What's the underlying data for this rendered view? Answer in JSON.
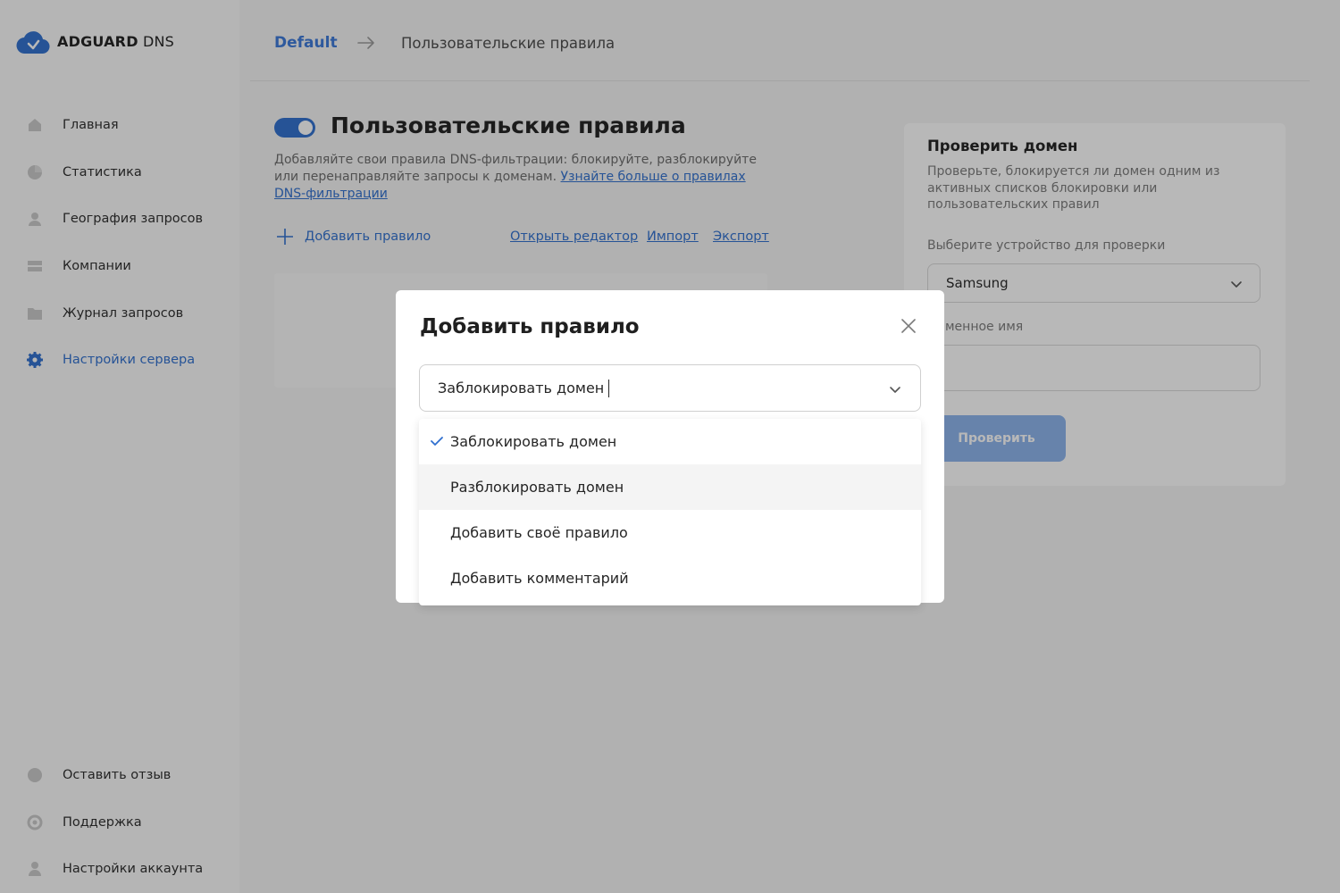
{
  "app": {
    "logo_bold": "ADGUARD",
    "logo_light": " DNS"
  },
  "sidebar": {
    "items": [
      {
        "label": "Главная",
        "icon": "home-icon"
      },
      {
        "label": "Статистика",
        "icon": "pie-chart-icon"
      },
      {
        "label": "География запросов",
        "icon": "user-icon"
      },
      {
        "label": "Компании",
        "icon": "companies-icon"
      },
      {
        "label": "Журнал запросов",
        "icon": "folder-icon"
      },
      {
        "label": "Настройки сервера",
        "icon": "gear-icon",
        "active": true
      }
    ],
    "bottom_items": [
      {
        "label": "Оставить отзыв",
        "icon": "chat-icon"
      },
      {
        "label": "Поддержка",
        "icon": "support-icon"
      },
      {
        "label": "Настройки аккаунта",
        "icon": "account-icon"
      }
    ]
  },
  "header": {
    "breadcrumb_link": "Default",
    "breadcrumb_current": "Пользовательские правила"
  },
  "main": {
    "toggle_on": true,
    "title": "Пользовательские правила",
    "description": "Добавляйте свои правила DNS-фильтрации: блокируйте, разблокируйте или перенаправляйте запросы к доменам. ",
    "description_link": "Узнайте больше о правилах DNS-фильтрации",
    "add_rule": "Добавить правило",
    "open_editor": "Открыть редактор",
    "import": "Импорт",
    "export": "Экспорт"
  },
  "check_panel": {
    "title": "Проверить домен",
    "description": "Проверьте, блокируется ли домен одним из активных списков блокировки или пользовательских правил",
    "device_label": "Выберите устройство для проверки",
    "device_value": "Samsung",
    "domain_label": "менное имя",
    "domain_value": "",
    "button": "Проверить"
  },
  "modal": {
    "title": "Добавить правило",
    "select_value": "Заблокировать домен",
    "options": [
      {
        "label": "Заблокировать домен",
        "selected": true
      },
      {
        "label": "Разблокировать домен",
        "selected": false
      },
      {
        "label": "Добавить своё правило",
        "selected": false
      },
      {
        "label": "Добавить комментарий",
        "selected": false
      }
    ]
  },
  "colors": {
    "accent": "#2f6fcf",
    "link": "#3a78d8",
    "button_disabled": "#8cb3ec",
    "overlay": "rgba(20,20,20,0.30)"
  }
}
